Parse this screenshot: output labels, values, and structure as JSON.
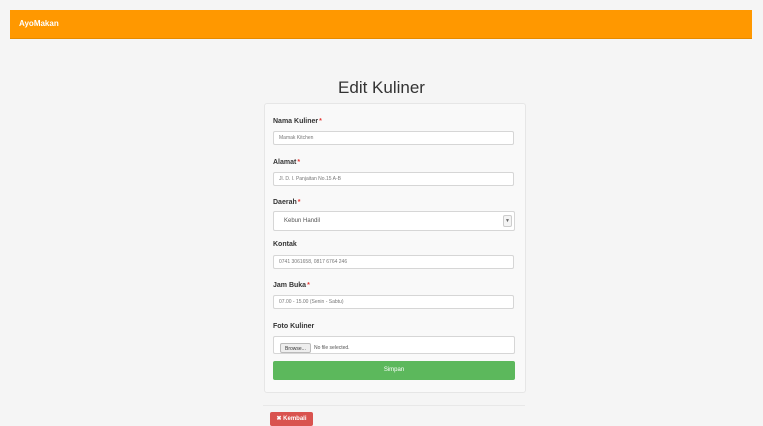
{
  "app": {
    "brand": "AyoMakan"
  },
  "page": {
    "title": "Edit Kuliner"
  },
  "form": {
    "nama": {
      "label": "Nama Kuliner",
      "required_mark": "*",
      "value": "Mamak Kitchen"
    },
    "alamat": {
      "label": "Alamat",
      "required_mark": "*",
      "value": "Jl. D. I. Panjaitan No.15 A-B"
    },
    "daerah": {
      "label": "Daerah",
      "required_mark": "*",
      "value": "Kebun Handil",
      "arrow_icon": "chevron-down-icon"
    },
    "kontak": {
      "label": "Kontak",
      "value": "0741 3061658, 0817 6764 246"
    },
    "jam_buka": {
      "label": "Jam Buka",
      "required_mark": "*",
      "value": "07.00 - 15.00 (Senin - Sabtu)"
    },
    "foto": {
      "label": "Foto Kuliner",
      "browse_label": "Browse...",
      "status": "No file selected."
    },
    "save_label": "Simpan"
  },
  "footer": {
    "back_label": "✖ Kembali"
  },
  "colors": {
    "navbar": "#ff9800",
    "save": "#5cb85c",
    "back": "#d9534f",
    "required": "#e53935"
  }
}
